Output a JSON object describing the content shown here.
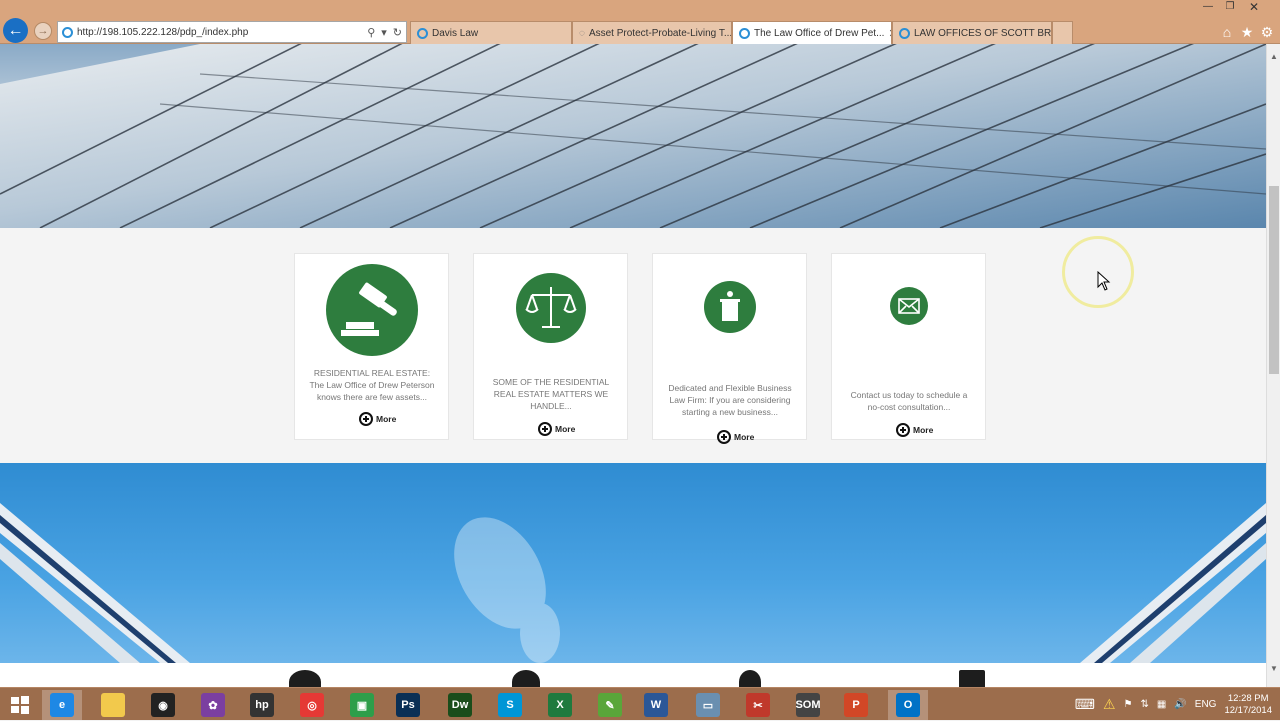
{
  "browser": {
    "address": "http://198.105.222.128/pdp_/index.php",
    "tabs": [
      {
        "label": "Davis Law",
        "active": false
      },
      {
        "label": "Asset Protect-Probate-Living T...",
        "active": false
      },
      {
        "label": "The Law Office of Drew Pet...",
        "active": true
      },
      {
        "label": "LAW OFFICES OF SCOTT BRAD...",
        "active": false
      }
    ],
    "close_glyph": "✕",
    "back_glyph": "←",
    "forward_glyph": "→"
  },
  "services": [
    {
      "icon": "gavel-icon",
      "text": "RESIDENTIAL REAL ESTATE: The Law Office of Drew Peterson knows there are few assets...",
      "more": "More"
    },
    {
      "icon": "scales-icon",
      "text": "SOME OF THE RESIDENTIAL REAL ESTATE MATTERS WE HANDLE...",
      "more": "More"
    },
    {
      "icon": "podium-icon",
      "text": "Dedicated and Flexible Business Law Firm: If you are considering starting a new business...",
      "more": "More"
    },
    {
      "icon": "envelope-icon",
      "text": "Contact us today to schedule a no-cost consultation...",
      "more": "More"
    }
  ],
  "taskbar": {
    "apps": [
      {
        "name": "internet-explorer",
        "glyph": "e",
        "color": "#1e88e5",
        "active": true
      },
      {
        "name": "file-explorer",
        "glyph": "",
        "color": "#f2c94c",
        "active": false
      },
      {
        "name": "camera-app",
        "glyph": "◉",
        "color": "#222222",
        "active": false
      },
      {
        "name": "paint-app",
        "glyph": "✿",
        "color": "#7b3fa0",
        "active": false
      },
      {
        "name": "hp-app",
        "glyph": "hp",
        "color": "#333333",
        "active": false
      },
      {
        "name": "chrome",
        "glyph": "◎",
        "color": "#e53935",
        "active": false
      },
      {
        "name": "store-app",
        "glyph": "▣",
        "color": "#2e9e4a",
        "active": false
      },
      {
        "name": "photoshop",
        "glyph": "Ps",
        "color": "#0a2f55",
        "active": false
      },
      {
        "name": "dreamweaver",
        "glyph": "Dw",
        "color": "#1b4d1b",
        "active": false
      },
      {
        "name": "skype",
        "glyph": "S",
        "color": "#0096d6",
        "active": false
      },
      {
        "name": "excel",
        "glyph": "X",
        "color": "#1f7a3e",
        "active": false
      },
      {
        "name": "evernote",
        "glyph": "✎",
        "color": "#5aa63a",
        "active": false
      },
      {
        "name": "word",
        "glyph": "W",
        "color": "#2b5797",
        "active": false
      },
      {
        "name": "image-viewer",
        "glyph": "▭",
        "color": "#6a8fb0",
        "active": false
      },
      {
        "name": "snip-tool",
        "glyph": "✂",
        "color": "#c0392b",
        "active": false
      },
      {
        "name": "som-app",
        "glyph": "SOM",
        "color": "#444444",
        "active": false
      },
      {
        "name": "powerpoint",
        "glyph": "P",
        "color": "#d24726",
        "active": false
      },
      {
        "name": "outlook",
        "glyph": "O",
        "color": "#0072c6",
        "active": true
      }
    ],
    "language": "ENG",
    "time": "12:28 PM",
    "date": "12/17/2014"
  }
}
